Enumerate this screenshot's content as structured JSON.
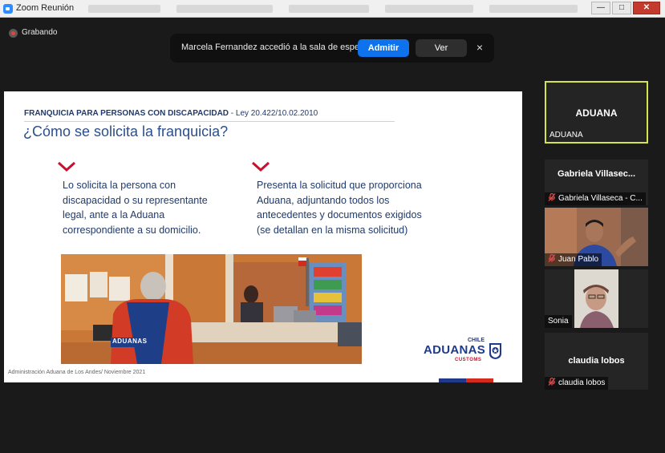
{
  "window": {
    "title": "Zoom Reunión"
  },
  "window_buttons": {
    "minimize": "—",
    "maximize": "□",
    "close": "✕"
  },
  "recording": {
    "label": "Grabando"
  },
  "notification": {
    "message": "Marcela Fernandez accedió a la sala de espera",
    "admit_label": "Admitir",
    "view_label": "Ver",
    "close_label": "×"
  },
  "slide": {
    "header_bold": "FRANQUICIA PARA PERSONAS CON DISCAPACIDAD",
    "header_law": " - Ley 20.422/10.02.2010",
    "title": "¿Cómo se solicita la franquicia?",
    "col1_lines": [
      "Lo solicita la persona con",
      "discapacidad o su representante",
      "legal, ante a la Aduana",
      "correspondiente a su domicilio."
    ],
    "col2_lines": [
      "Presenta la solicitud que proporciona",
      "Aduana, adjuntando todos los",
      "antecedentes y documentos exigidos",
      "(se detallan en la misma solicitud)"
    ],
    "photo_vest_text": "ADUANAS",
    "footer": "Administración Aduana de Los Andes/ Noviembre 2021",
    "logo": {
      "chile": "CHILE",
      "main": "ADUANAS",
      "sub": "CUSTOMS"
    }
  },
  "participants": [
    {
      "display": "ADUANA",
      "label": "ADUANA",
      "muted": false,
      "active": true
    },
    {
      "display": "Gabriela Villasec...",
      "label": "Gabriela Villaseca - C...",
      "muted": true,
      "active": false
    },
    {
      "display": "",
      "label": "Juan Pablo",
      "muted": true,
      "active": false,
      "video": true
    },
    {
      "display": "",
      "label": "Sonia",
      "muted": false,
      "active": false,
      "video": true
    },
    {
      "display": "claudia lobos",
      "label": "claudia lobos",
      "muted": true,
      "active": false
    }
  ],
  "colors": {
    "accent": "#0e72ed",
    "active_speaker": "#d7e34a",
    "slide_text": "#1f3a6b",
    "chevron": "#c8102e"
  }
}
